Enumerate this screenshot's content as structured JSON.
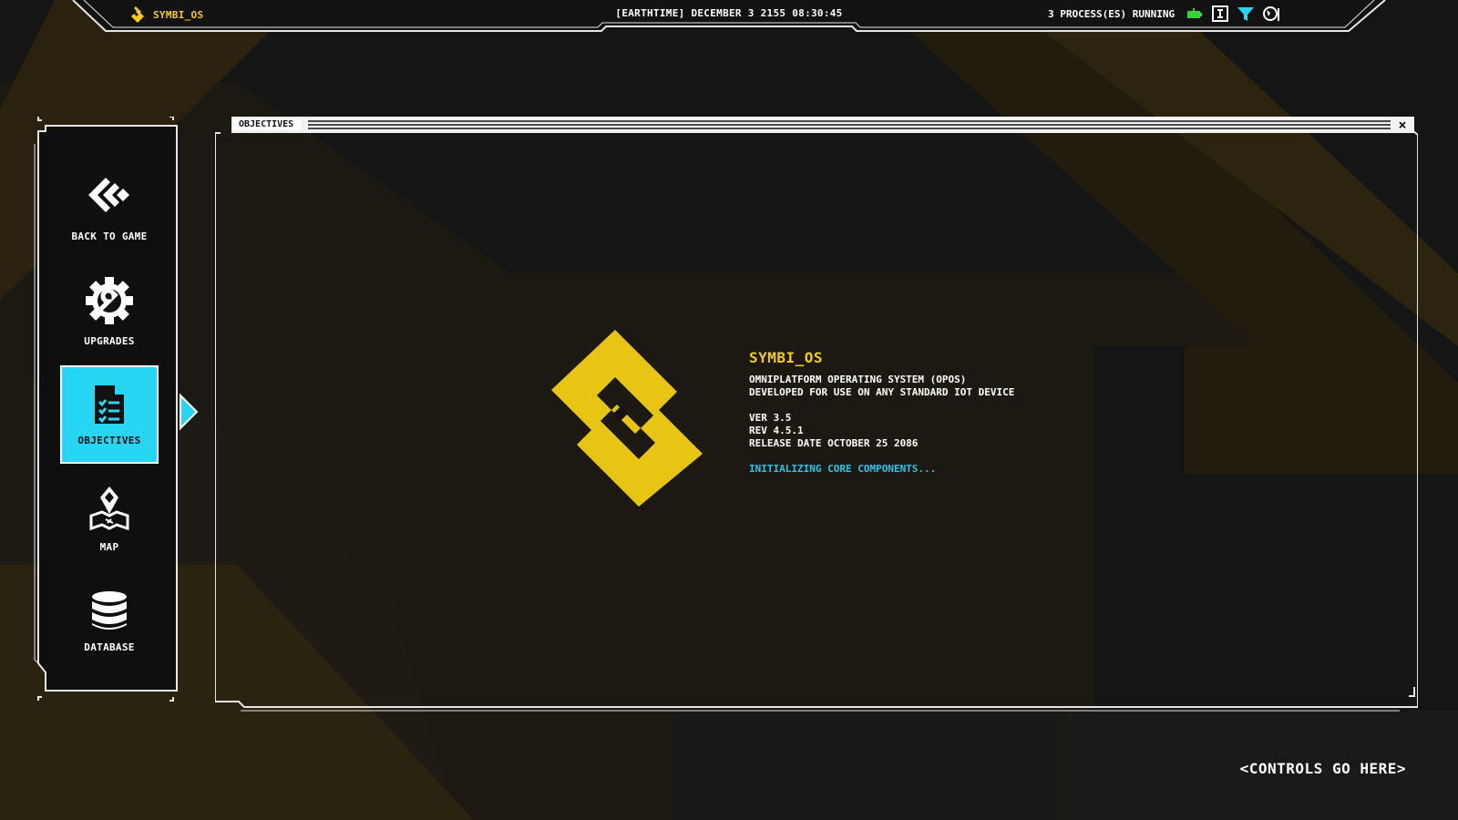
{
  "topbar": {
    "os_name": "SYMBI_OS",
    "datetime": "[EARTHTIME] DECEMBER 3 2155 08:30:45",
    "processes": "3 PROCESS(ES) RUNNING",
    "icons": [
      "battery-icon",
      "terminal-icon",
      "filter-icon",
      "globe-icon"
    ]
  },
  "sidebar": {
    "items": [
      {
        "label": "BACK TO GAME",
        "icon": "back-arrows-icon"
      },
      {
        "label": "UPGRADES",
        "icon": "wrench-gear-icon"
      },
      {
        "label": "OBJECTIVES",
        "icon": "checklist-document-icon",
        "active": true
      },
      {
        "label": "MAP",
        "icon": "map-pin-icon"
      },
      {
        "label": "DATABASE",
        "icon": "database-icon"
      }
    ]
  },
  "window": {
    "title": "OBJECTIVES",
    "close_label": "×"
  },
  "info": {
    "title": "SYMBI_OS",
    "line1": "OMNIPLATFORM OPERATING SYSTEM (OPOS)",
    "line2": "DEVELOPED FOR USE ON ANY STANDARD IOT DEVICE",
    "ver": "VER 3.5",
    "rev": "REV 4.5.1",
    "release": "RELEASE DATE OCTOBER 25 2086",
    "status": "INITIALIZING CORE COMPONENTS..."
  },
  "footer": {
    "controls": "<CONTROLS GO HERE>"
  },
  "colors": {
    "accent_yellow": "#f1cc1a",
    "accent_cyan": "#27d6f2",
    "background": "#141414"
  }
}
